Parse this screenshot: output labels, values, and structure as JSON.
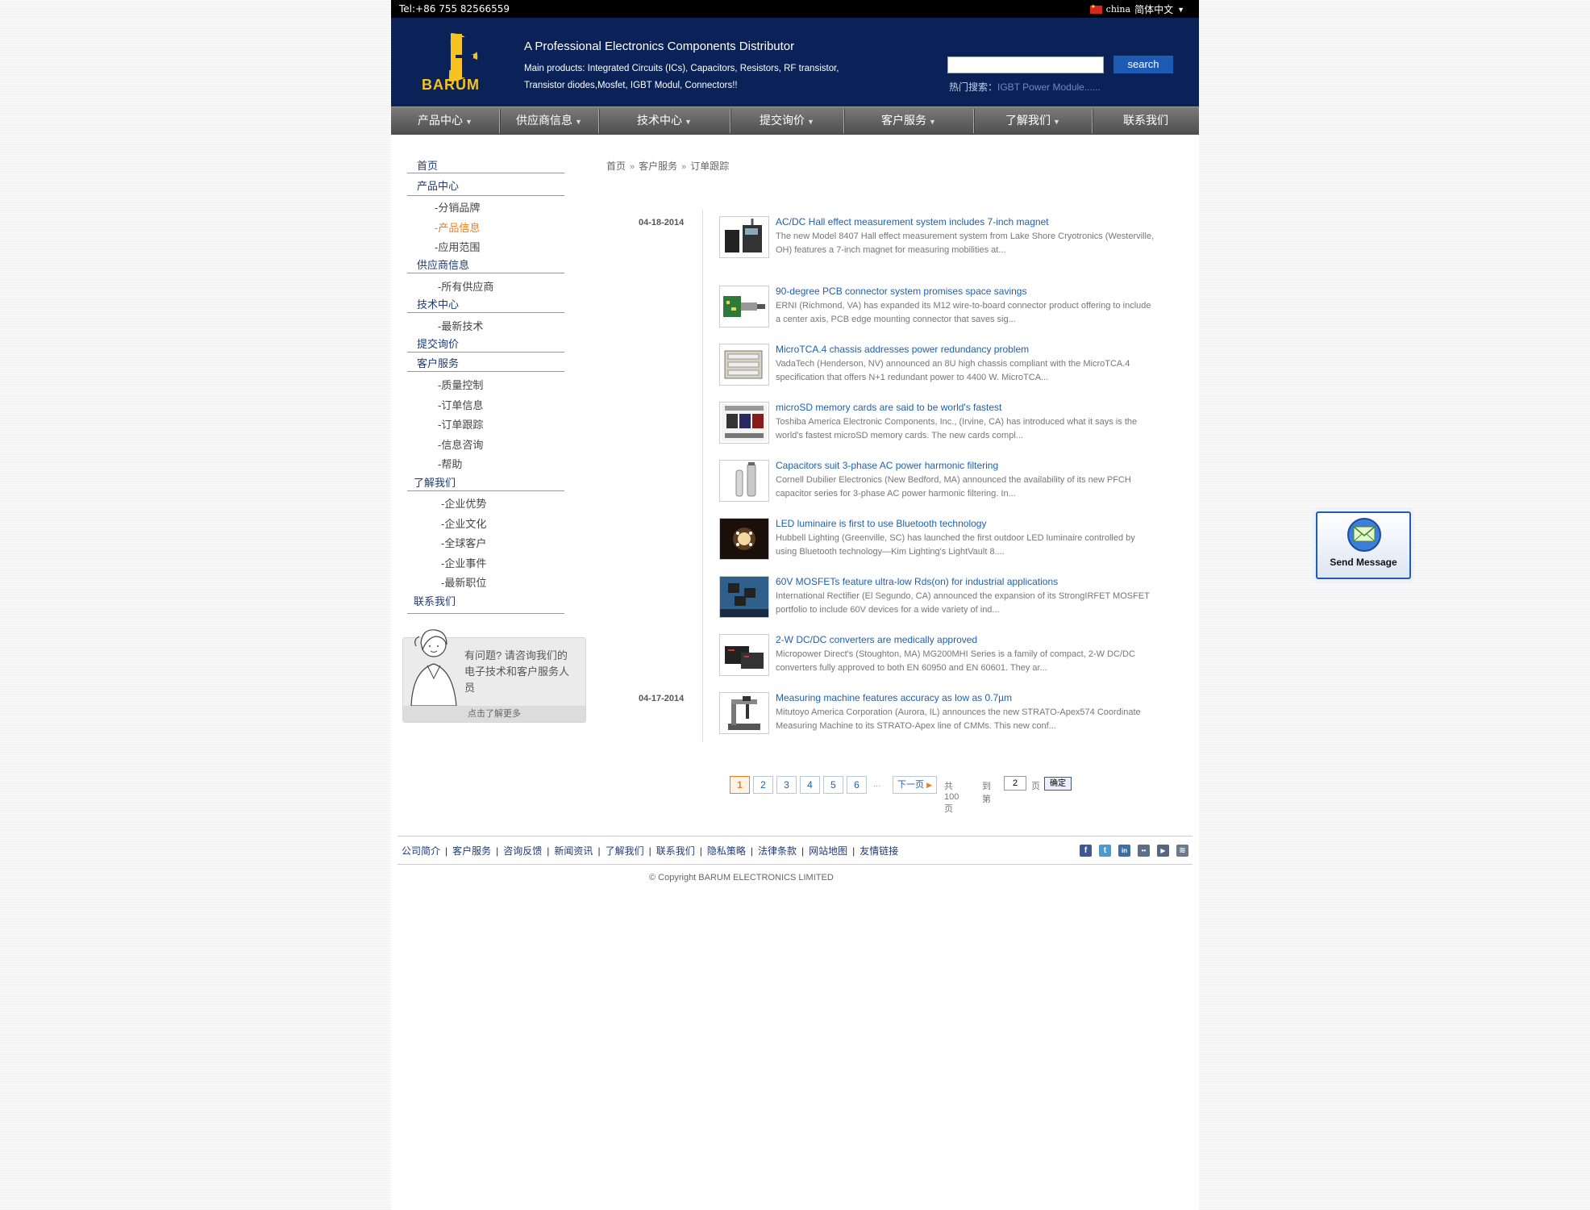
{
  "topbar": {
    "tel": "Tel:+86 755 82566559",
    "lang_region": "china",
    "lang_label": "简体中文"
  },
  "header": {
    "logo_text": "BARUM",
    "tagline": "A Professional Electronics Components Distributor",
    "products": "Main products: Integrated Circuits (ICs), Capacitors, Resistors, RF transistor, Transistor diodes,Mosfet, IGBT Modul, Connectors!!",
    "search_value": "",
    "search_button": "search",
    "hot_label": "热门搜索：",
    "hot_link": "IGBT Power Module......"
  },
  "nav": [
    {
      "label": "产品中心"
    },
    {
      "label": "供应商信息"
    },
    {
      "label": "技术中心"
    },
    {
      "label": "提交询价"
    },
    {
      "label": "客户服务"
    },
    {
      "label": "了解我们"
    },
    {
      "label": "联系我们"
    }
  ],
  "sidebar": {
    "home": "首页",
    "products": "产品中心",
    "products_sub": [
      "-分销品牌",
      "-产品信息",
      "-应用范围"
    ],
    "suppliers": "供应商信息",
    "suppliers_sub": [
      "-所有供应商"
    ],
    "tech": "技术中心",
    "tech_sub": [
      "-最新技术"
    ],
    "inquiry": "提交询价",
    "service": "客户服务",
    "service_sub": [
      "-质量控制",
      "-订单信息",
      "-订单跟踪",
      "-信息咨询",
      "-帮助"
    ],
    "about": "了解我们",
    "about_sub": [
      "-企业优势",
      "-企业文化",
      "-全球客户",
      "-企业事件",
      "-最新职位"
    ],
    "contact": "联系我们",
    "help_text": "有问题? 请咨询我们的电子技术和客户服务人员",
    "help_more": "点击了解更多"
  },
  "breadcrumb": {
    "home": "首页",
    "section": "客户服务",
    "current": "订单跟踪"
  },
  "dates": [
    "04-18-2014",
    "04-17-2014"
  ],
  "news": [
    {
      "title": "AC/DC Hall effect measurement system includes 7-inch magnet",
      "desc": "The new Model 8407 Hall effect measurement system from Lake Shore Cryotronics (Westerville, OH) features a 7-inch magnet for measuring mobilities at...",
      "thumb": "measurement-system-photo"
    },
    {
      "title": "90-degree PCB connector system promises space savings",
      "desc": "ERNI (Richmond, VA) has expanded its M12 wire-to-board connector product offering to include a center axis, PCB edge mounting connector that saves sig...",
      "thumb": "pcb-connector-photo"
    },
    {
      "title": "MicroTCA.4 chassis addresses power redundancy problem",
      "desc": "VadaTech (Henderson, NV) announced an 8U high chassis compliant with the MicroTCA.4 specification that offers N+1 redundant power to 4400 W. MicroTCA...",
      "thumb": "chassis-photo"
    },
    {
      "title": "microSD memory cards are said to be world's fastest",
      "desc": "Toshiba America Electronic Components, Inc., (Irvine, CA) has introduced what it says is the world's fastest microSD memory cards. The new cards compl...",
      "thumb": "microsd-photo"
    },
    {
      "title": "Capacitors suit 3-phase AC power harmonic filtering",
      "desc": "Cornell Dubilier Electronics (New Bedford, MA) announced the availability of its new PFCH capacitor series for 3-phase AC power harmonic filtering. In...",
      "thumb": "capacitor-photo"
    },
    {
      "title": "LED luminaire is first to use Bluetooth technology",
      "desc": "Hubbell Lighting (Greenville, SC) has launched the first outdoor LED luminaire controlled by using Bluetooth technology—Kim Lighting's LightVault 8....",
      "thumb": "led-luminaire-photo"
    },
    {
      "title": "60V MOSFETs feature ultra-low Rds(on) for industrial applications",
      "desc": "International Rectifier (El Segundo, CA) announced the expansion of its StrongIRFET MOSFET portfolio to include 60V devices for a wide variety of ind...",
      "thumb": "mosfet-photo"
    },
    {
      "title": "2-W DC/DC converters are medically approved",
      "desc": "Micropower Direct's (Stoughton, MA) MG200MHI Series is a family of compact, 2-W DC/DC converters fully approved to both EN 60950 and EN 60601. They ar...",
      "thumb": "dcdc-converter-photo"
    },
    {
      "title": "Measuring machine features accuracy as low as 0.7µm",
      "desc": "Mitutoyo America Corporation (Aurora, IL) announces the new STRATO-Apex574 Coordinate Measuring Machine to its STRATO-Apex line of CMMs. This new conf...",
      "thumb": "cmm-photo"
    }
  ],
  "pager": {
    "pages": [
      "1",
      "2",
      "3",
      "4",
      "5",
      "6"
    ],
    "current": "1",
    "ellipsis": "...",
    "next": "下一页",
    "total": "共100页",
    "goto": "到第",
    "goto_value": "2",
    "page_unit": "页",
    "ok": "确定"
  },
  "footer": {
    "links": [
      "公司简介",
      "客户服务",
      "咨询反馈",
      "新闻资讯",
      "了解我们",
      "联系我们",
      "隐私策略",
      "法律条款",
      "网站地图",
      "友情链接"
    ],
    "social": [
      {
        "icon": "facebook-icon",
        "glyph": "f",
        "color": "#3b5998"
      },
      {
        "icon": "twitter-icon",
        "glyph": "t",
        "color": "#4a9ad4"
      },
      {
        "icon": "linkedin-icon",
        "glyph": "in",
        "color": "#3b6fa6"
      },
      {
        "icon": "flickr-icon",
        "glyph": "••",
        "color": "#5a6f8a"
      },
      {
        "icon": "youtube-icon",
        "glyph": "▶",
        "color": "#556680"
      },
      {
        "icon": "rss-icon",
        "glyph": "≋",
        "color": "#6a7a90"
      }
    ],
    "copyright": "© Copyright BARUM ELECTRONICS LIMITED"
  },
  "send_message": "Send Message",
  "colors": {
    "header_bg": "#0a2257",
    "logo_yellow": "#f5c422",
    "link_blue": "#1e5fb5",
    "active_orange": "#f07c1c"
  }
}
